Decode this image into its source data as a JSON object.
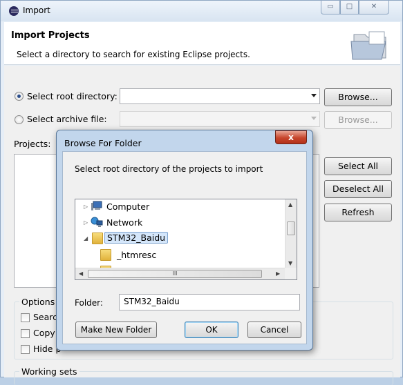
{
  "window": {
    "title": "Import",
    "min_glyph": "▭",
    "max_glyph": "□",
    "close_glyph": "✕"
  },
  "banner": {
    "title": "Import Projects",
    "subtitle": "Select a directory to search for existing Eclipse projects."
  },
  "source": {
    "root_label": "Select root directory:",
    "root_value": "",
    "root_selected": true,
    "archive_label": "Select archive file:",
    "archive_value": "",
    "browse_label": "Browse...",
    "browse_label_2": "Browse..."
  },
  "projects": {
    "label": "Projects:",
    "select_all": "Select All",
    "deselect_all": "Deselect All",
    "refresh": "Refresh"
  },
  "options": {
    "label": "Options",
    "items": [
      "Search",
      "Copy",
      "Hide p"
    ]
  },
  "working_sets": {
    "label": "Working sets"
  },
  "dialog": {
    "title": "Browse For Folder",
    "close_glyph": "x",
    "description": "Select root directory of the projects to import",
    "tree": [
      {
        "label": "Computer",
        "expanded": false
      },
      {
        "label": "Network",
        "expanded": false
      },
      {
        "label": "STM32_Baidu",
        "expanded": true,
        "selected": true
      },
      {
        "label": "_htmresc"
      }
    ],
    "folder_label": "Folder:",
    "folder_value": "STM32_Baidu",
    "make_new_folder": "Make New Folder",
    "ok": "OK",
    "cancel": "Cancel",
    "scroll_mid": "III"
  }
}
